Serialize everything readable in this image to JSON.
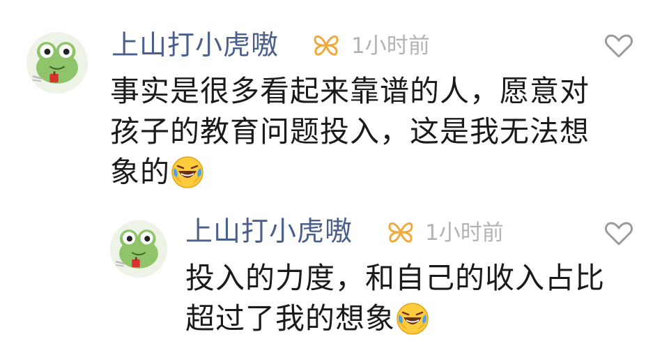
{
  "comments": [
    {
      "username": "上山打小虎嗷",
      "badge_icon": "butterfly-icon",
      "timestamp": "1小时前",
      "like_icon": "heart-outline-icon",
      "text_lines": [
        "事实是很多看起来靠谱的人，愿意对",
        "孩子的教育问题投入，这是我无法想",
        "象的"
      ],
      "emoji": "laughing-crying-face-emoji"
    },
    {
      "username": "上山打小虎嗷",
      "badge_icon": "butterfly-icon",
      "timestamp": "1小时前",
      "like_icon": "heart-outline-icon",
      "text_lines": [
        "投入的力度，和自己的收入占比",
        "超过了我的想象"
      ],
      "emoji": "laughing-crying-face-emoji"
    }
  ],
  "colors": {
    "username": "#4a5f8c",
    "timestamp": "#b3b3b3",
    "text": "#1a1a1a",
    "badge": "#f2a93b",
    "like": "#9a9a9a"
  }
}
